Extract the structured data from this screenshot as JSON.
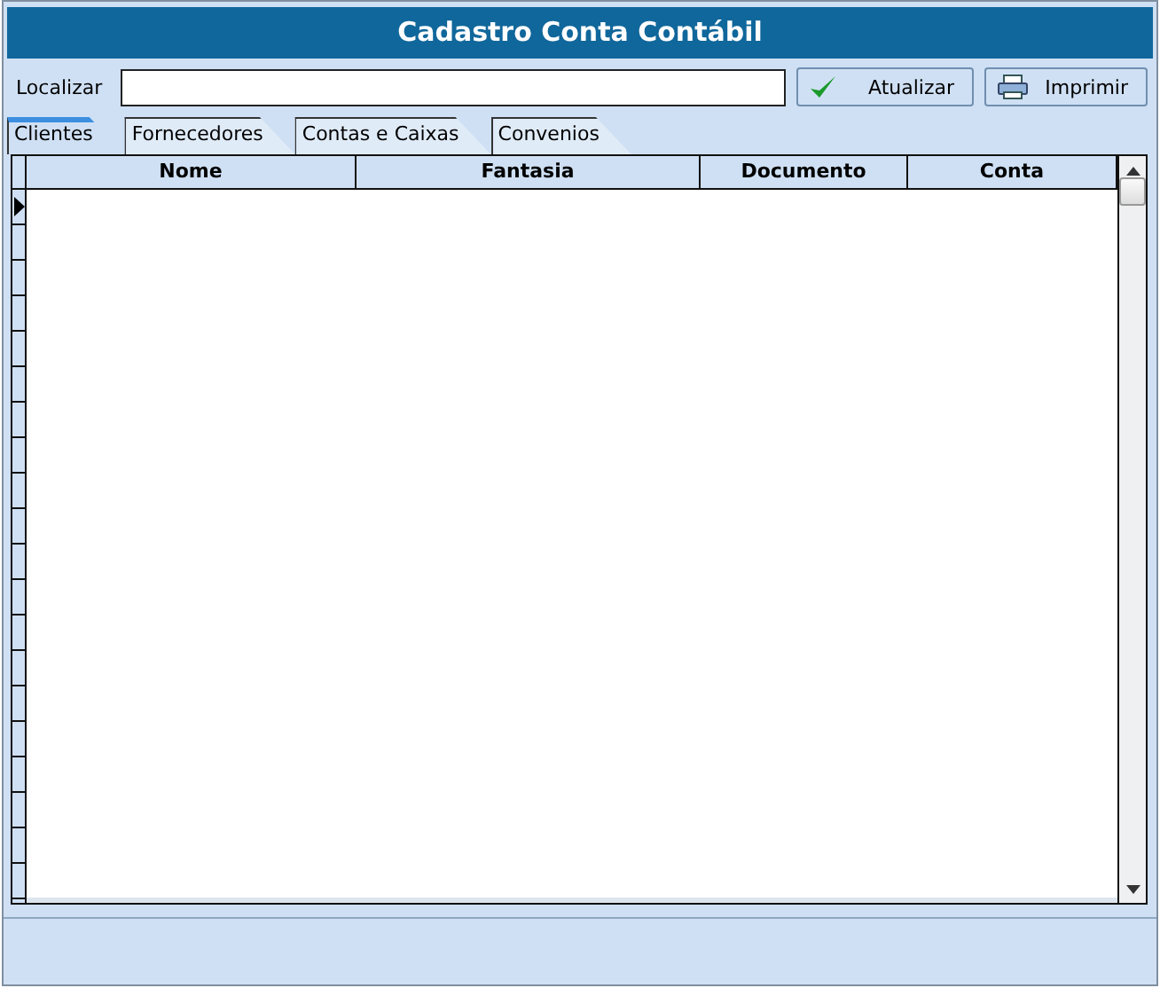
{
  "window": {
    "title": "Cadastro Conta Contábil"
  },
  "search": {
    "label": "Localizar"
  },
  "buttons": [
    {
      "label": "Atualizar",
      "kind": "refresh"
    },
    {
      "label": "Imprimir",
      "kind": "print"
    }
  ],
  "tabs": [
    {
      "label": "Clientes",
      "selected": true
    },
    {
      "label": "Fornecedores",
      "selected": false
    },
    {
      "label": "Contas e Caixas",
      "selected": false
    },
    {
      "label": "Convenios",
      "selected": false
    }
  ],
  "table": {
    "columns": [
      "Nome",
      "Fantasia",
      "Documento",
      "Conta"
    ],
    "rows": [
      {
        "selected": true
      },
      {
        "selected": false
      },
      {
        "selected": false
      },
      {
        "selected": false
      },
      {
        "selected": false
      },
      {
        "selected": false
      },
      {
        "selected": false
      },
      {
        "selected": false
      },
      {
        "selected": false
      },
      {
        "selected": false
      },
      {
        "selected": false
      },
      {
        "selected": false
      },
      {
        "selected": false
      },
      {
        "selected": false
      },
      {
        "selected": false
      },
      {
        "selected": false
      },
      {
        "selected": false
      },
      {
        "selected": false
      },
      {
        "selected": false
      },
      {
        "selected": false
      }
    ]
  }
}
